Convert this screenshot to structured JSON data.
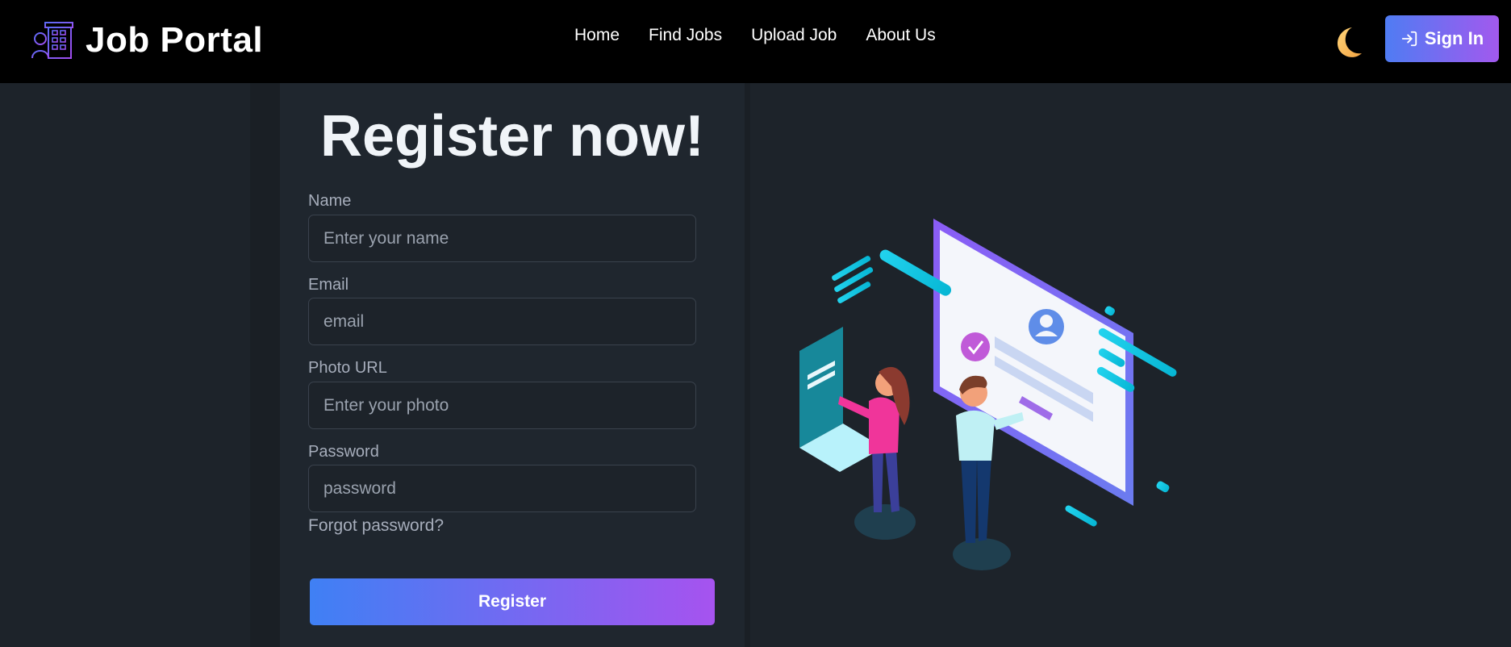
{
  "navbar": {
    "brand_name": "Job Portal",
    "brand_icon": "office-building-person-icon",
    "links": [
      "Home",
      "Find Jobs",
      "Upload Job",
      "About Us"
    ],
    "theme_toggle_icon": "crescent-moon-icon",
    "signin_label": "Sign In",
    "signin_icon": "sign-in-arrow-icon"
  },
  "form": {
    "title": "Register now!",
    "fields": [
      {
        "label": "Name",
        "placeholder": "Enter your name",
        "value": ""
      },
      {
        "label": "Email",
        "placeholder": "email",
        "value": ""
      },
      {
        "label": "Photo URL",
        "placeholder": "Enter your photo",
        "value": ""
      },
      {
        "label": "Password",
        "placeholder": "password",
        "value": ""
      }
    ],
    "forgot_label": "Forgot password?",
    "register_label": "Register"
  },
  "illustration": {
    "subject": "isometric-registration-screen-with-two-people"
  },
  "colors": {
    "navbar_bg": "#000000",
    "page_bg": "#1d232a",
    "card_bg": "#1f262e",
    "accent_start": "#4f7cf3",
    "accent_end": "#a259ee"
  }
}
